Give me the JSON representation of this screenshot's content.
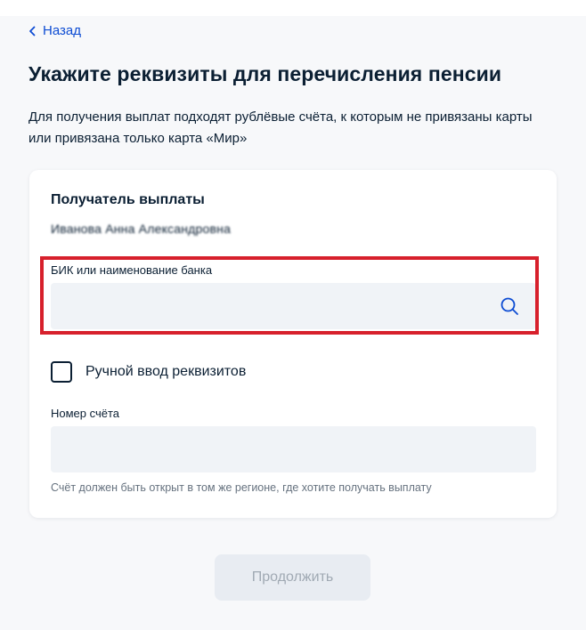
{
  "nav": {
    "back_label": "Назад"
  },
  "page": {
    "title": "Укажите реквизиты для перечисления пенсии",
    "description": "Для получения выплат подходят рублёвые счёта, к которым не привязаны карты или привязана только карта «Мир»"
  },
  "card": {
    "title": "Получатель выплаты",
    "recipient_name": "Иванова Анна Александровна",
    "bank_field": {
      "label": "БИК или наименование банка",
      "value": "",
      "placeholder": ""
    },
    "manual_entry": {
      "label": "Ручной ввод реквизитов",
      "checked": false
    },
    "account_field": {
      "label": "Номер счёта",
      "value": "",
      "placeholder": "",
      "hint": "Счёт должен быть открыт в том же регионе, где хотите получать выплату"
    }
  },
  "actions": {
    "continue_label": "Продолжить"
  },
  "colors": {
    "accent": "#0d4cd3",
    "highlight": "#d7202c",
    "background": "#f7f8fa",
    "input_bg": "#f0f3f7",
    "button_disabled_bg": "#e8ecf2",
    "button_disabled_text": "#a0a9b3"
  },
  "icons": {
    "back": "chevron-left-icon",
    "search": "search-icon"
  }
}
